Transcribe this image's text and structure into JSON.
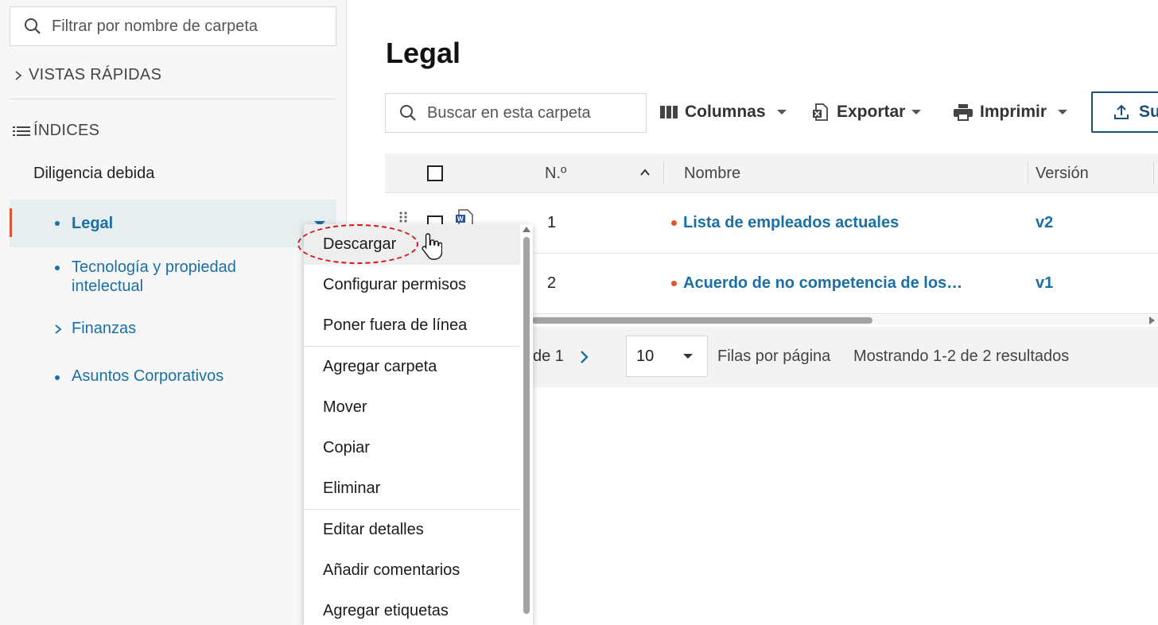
{
  "sidebar": {
    "filter_placeholder": "Filtrar por nombre de carpeta",
    "quick_views_label": "VISTAS RÁPIDAS",
    "indexes_label": "ÍNDICES",
    "tree_parent": "Diligencia debida",
    "items": [
      {
        "label": "Legal",
        "selected": true
      },
      {
        "label": "Tecnología y propiedad intelectual"
      },
      {
        "label": "Finanzas",
        "expandable": true
      },
      {
        "label": "Asuntos Corporativos"
      }
    ]
  },
  "main": {
    "title": "Legal",
    "search_placeholder": "Buscar en esta carpeta",
    "toolbar": {
      "columns_label": "Columnas",
      "export_label": "Exportar",
      "print_label": "Imprimir",
      "upload_label": "Su"
    },
    "table": {
      "headers": {
        "number": "N.º",
        "name": "Nombre",
        "version": "Versión"
      },
      "rows": [
        {
          "number": "1",
          "name": "Lista de empleados actuales",
          "version": "v2"
        },
        {
          "number": "2",
          "name": "Acuerdo de no competencia de los…",
          "version": "v1"
        }
      ]
    },
    "pager": {
      "page_of": "de 1",
      "rows_per_page_value": "10",
      "rows_per_page_label": "Filas por página",
      "showing": "Mostrando 1-2 de 2 resultados"
    }
  },
  "context_menu": {
    "items": [
      "Descargar",
      "Configurar permisos",
      "Poner fuera de línea",
      "Agregar carpeta",
      "Mover",
      "Copiar",
      "Eliminar",
      "Editar detalles",
      "Añadir comentarios",
      "Agregar etiquetas"
    ]
  },
  "colors": {
    "accent": "#1a6fa6",
    "highlight": "#d0191e",
    "status_dot": "#e0552f"
  }
}
